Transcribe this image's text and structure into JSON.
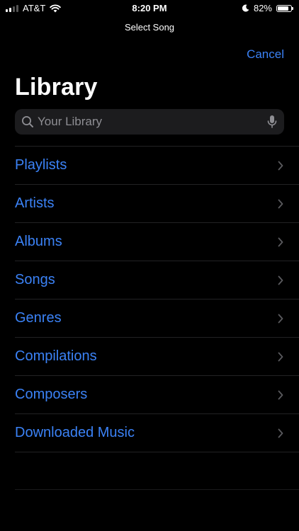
{
  "status_bar": {
    "carrier": "AT&T",
    "time": "8:20 PM",
    "battery": "82%",
    "battery_level": 0.82
  },
  "nav": {
    "title": "Select Song",
    "cancel_label": "Cancel"
  },
  "page": {
    "title": "Library"
  },
  "search": {
    "placeholder": "Your Library"
  },
  "library": {
    "items": [
      {
        "label": "Playlists"
      },
      {
        "label": "Artists"
      },
      {
        "label": "Albums"
      },
      {
        "label": "Songs"
      },
      {
        "label": "Genres"
      },
      {
        "label": "Compilations"
      },
      {
        "label": "Composers"
      },
      {
        "label": "Downloaded Music"
      }
    ]
  },
  "colors": {
    "accent": "#3b82f6",
    "background": "#000000",
    "search_field": "#1c1c1e",
    "separator": "#222224",
    "placeholder": "#8e8e93"
  },
  "icons": {
    "search": "search-icon",
    "mic": "microphone-icon",
    "chevron": "chevron-right-icon",
    "wifi": "wifi-icon",
    "moon": "moon-icon",
    "battery": "battery-icon",
    "signal": "signal-icon"
  }
}
